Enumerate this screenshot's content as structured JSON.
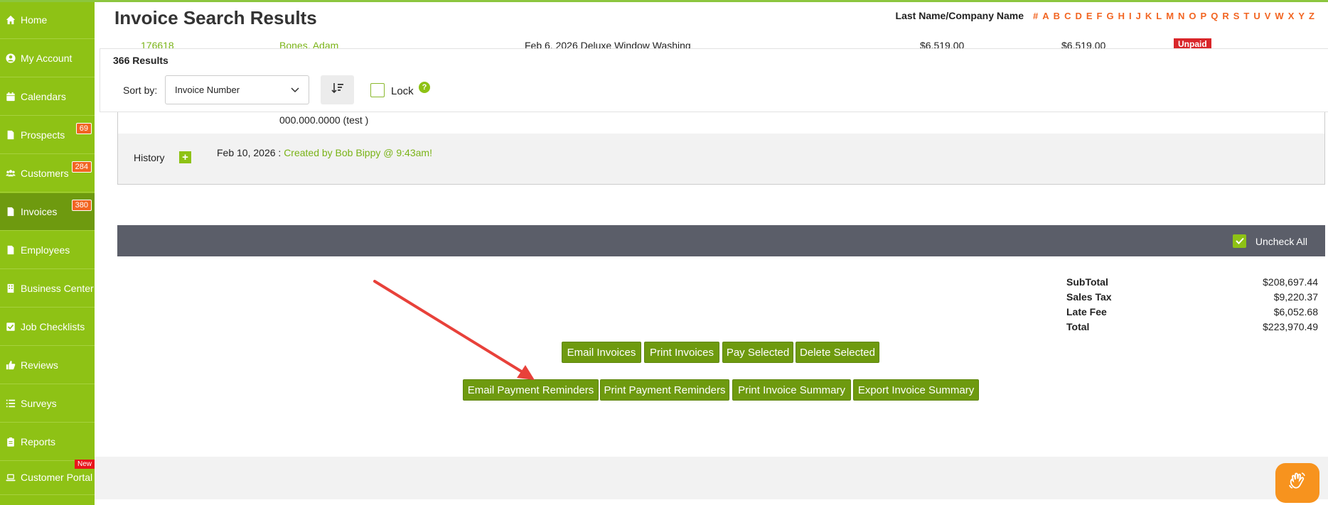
{
  "sidebar": {
    "items": [
      {
        "label": "Home",
        "icon": "home-icon"
      },
      {
        "label": "My Account",
        "icon": "user-icon"
      },
      {
        "label": "Calendars",
        "icon": "calendar-icon"
      },
      {
        "label": "Prospects",
        "icon": "document-icon",
        "badge": "69"
      },
      {
        "label": "Customers",
        "icon": "users-icon",
        "badge": "284"
      },
      {
        "label": "Invoices",
        "icon": "document-icon",
        "badge": "380",
        "active": true
      },
      {
        "label": "Employees",
        "icon": "document-icon"
      },
      {
        "label": "Business Center",
        "icon": "building-icon"
      },
      {
        "label": "Job Checklists",
        "icon": "checkbox-icon"
      },
      {
        "label": "Reviews",
        "icon": "thumbs-up-icon"
      },
      {
        "label": "Surveys",
        "icon": "list-icon"
      },
      {
        "label": "Reports",
        "icon": "clipboard-icon"
      },
      {
        "label": "Customer Portal",
        "icon": "laptop-icon",
        "badge_new": "New"
      }
    ]
  },
  "header": {
    "title": "Invoice Search Results",
    "alpha_label": "Last Name/Company Name",
    "letters": [
      "#",
      "A",
      "B",
      "C",
      "D",
      "E",
      "F",
      "G",
      "H",
      "I",
      "J",
      "K",
      "L",
      "M",
      "N",
      "O",
      "P",
      "Q",
      "R",
      "S",
      "T",
      "U",
      "V",
      "W",
      "X",
      "Y",
      "Z"
    ]
  },
  "peek_row": {
    "invoice_no": "176618",
    "customer": "Bones, Adam",
    "date_service": "Feb 6, 2026  Deluxe Window Washing",
    "amount": "$6,519.00",
    "balance": "$6,519.00",
    "status": "Unpaid"
  },
  "results": {
    "count": "366 Results",
    "sort_label": "Sort by:",
    "sort_value": "Invoice Number",
    "lock_label": "Lock",
    "help": "?"
  },
  "detail": {
    "phone": "000.000.0000 (test )",
    "history_label": "History",
    "history_date": "Feb 10, 2026 : ",
    "history_entry": "Created by Bob Bippy @ 9:43am!"
  },
  "select_bar": {
    "uncheck_label": "Uncheck All"
  },
  "totals": [
    {
      "label": "SubTotal",
      "value": "$208,697.44"
    },
    {
      "label": "Sales Tax",
      "value": "$9,220.37"
    },
    {
      "label": "Late Fee",
      "value": "$6,052.68"
    },
    {
      "label": "Total",
      "value": "$223,970.49"
    }
  ],
  "actions": {
    "email_invoices": "Email Invoices",
    "print_invoices": "Print Invoices",
    "pay_selected": "Pay Selected",
    "delete_selected": "Delete Selected",
    "email_payment_reminders": "Email Payment Reminders",
    "print_payment_reminders": "Print Payment Reminders",
    "print_invoice_summary": "Print Invoice Summary",
    "export_invoice_summary": "Export Invoice Summary"
  },
  "colors": {
    "sidebar": "#8ec215",
    "sidebar_active": "#6e9a0f",
    "accent_orange": "#f26522",
    "button": "#6e9a0f",
    "dark_bar": "#5b5e69",
    "annotation_arrow": "#e8413a"
  }
}
